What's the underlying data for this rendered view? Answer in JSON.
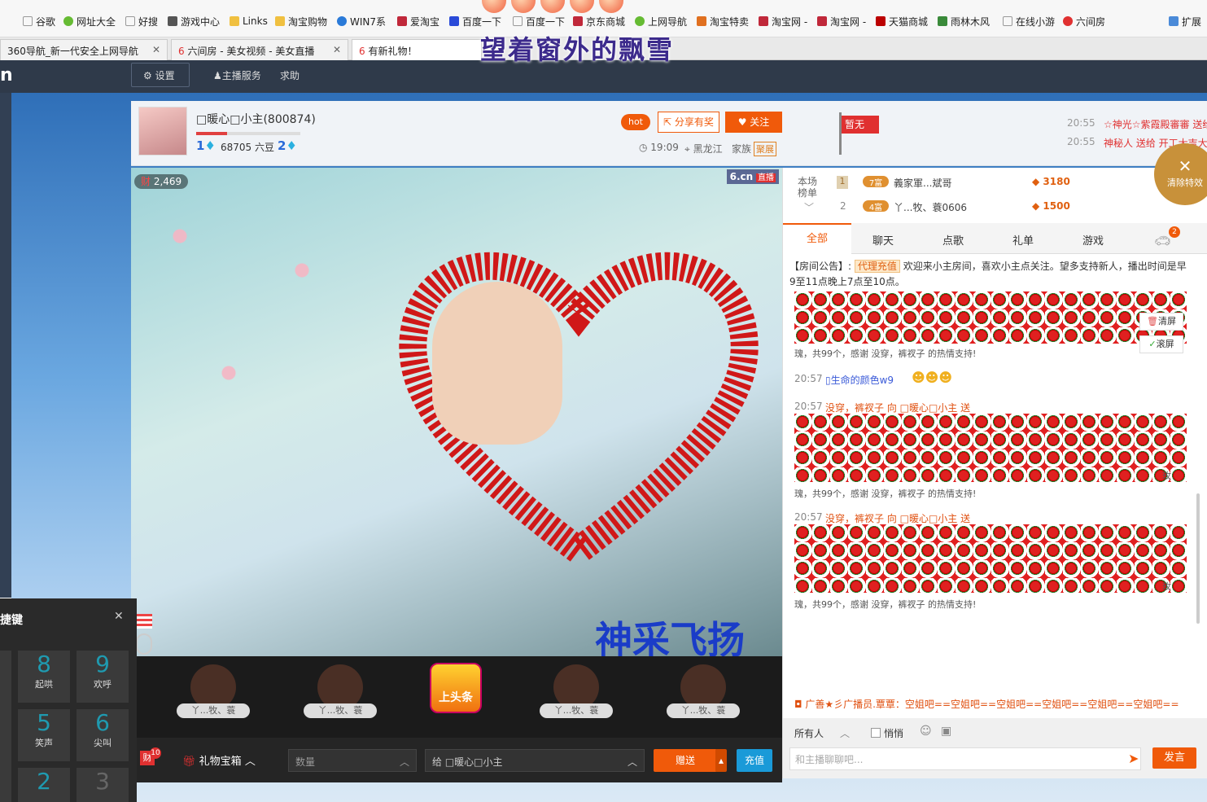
{
  "bookmarks": [
    {
      "label": "谷歌",
      "icon": "page-icon"
    },
    {
      "label": "网址大全",
      "icon": "360-icon"
    },
    {
      "label": "好搜",
      "icon": "page-icon"
    },
    {
      "label": "游戏中心",
      "icon": "gamepad-icon"
    },
    {
      "label": "Links",
      "icon": "folder-icon"
    },
    {
      "label": "淘宝购物",
      "icon": "folder-icon"
    },
    {
      "label": "WIN7系",
      "icon": "ie-icon"
    },
    {
      "label": "爱淘宝",
      "icon": "taobao-icon"
    },
    {
      "label": "百度一下",
      "icon": "baidu-icon"
    },
    {
      "label": "百度一下",
      "icon": "page-icon"
    },
    {
      "label": "京东商城",
      "icon": "jd-icon"
    },
    {
      "label": "上网导航",
      "icon": "360-icon"
    },
    {
      "label": "淘宝特卖",
      "icon": "taobao-icon"
    },
    {
      "label": "淘宝网 -",
      "icon": "jd-icon"
    },
    {
      "label": "淘宝网 -",
      "icon": "jd-icon"
    },
    {
      "label": "天猫商城",
      "icon": "tmall-icon"
    },
    {
      "label": "雨林木风",
      "icon": "tree-icon"
    },
    {
      "label": "在线小游",
      "icon": "page-icon"
    },
    {
      "label": "六间房",
      "icon": "6cn-icon"
    },
    {
      "label": "扩展",
      "icon": "extension-icon"
    }
  ],
  "tabs": [
    {
      "label": "360导航_新一代安全上网导航"
    },
    {
      "label": "六间房 - 美女视频 - 美女直播"
    },
    {
      "label": "有新礼物！"
    }
  ],
  "overlay_title": "望着窗外的飘雪",
  "topnav": {
    "settings": "设置",
    "anchor_service": "主播服务",
    "help": "求助"
  },
  "header": {
    "anchor_name": "□暖心□小主(800874)",
    "level_left": "1",
    "beans": "68705 六豆",
    "level_right": "2",
    "hot_label": "hot",
    "share_label": "分享有奖",
    "follow_label": "关注",
    "time": "19:09",
    "location": "黑龙江",
    "family_label": "家族",
    "family_badge": "聚展",
    "flag_label": "暂无",
    "notices": [
      {
        "time": "20:55",
        "text": "☆神光☆紫霞殿審審 送给"
      },
      {
        "time": "20:55",
        "text": "神秘人 送给 开工大吉大"
      }
    ]
  },
  "video": {
    "wealth_count": "2,469",
    "brand": "6.cn",
    "live": "直播",
    "banner": "神采飞扬"
  },
  "gifts": [
    {
      "name": "丫...牧、蓑"
    },
    {
      "name": "丫...牧、蓑"
    },
    {
      "name": "上头条"
    },
    {
      "name": "丫...牧、蓑"
    },
    {
      "name": "丫...牧、蓑"
    }
  ],
  "bottombar": {
    "wealth_badge": "10",
    "gift_box": "礼物宝箱",
    "quantity_placeholder": "数量",
    "give_to": "给 □暖心□小主",
    "send": "赠送",
    "recharge": "充值"
  },
  "ranking": {
    "label": "本场榜单",
    "rows": [
      {
        "rank": "1",
        "badge": "7富",
        "name": "義家軍...斌哥",
        "score": "3180"
      },
      {
        "rank": "2",
        "badge": "4富",
        "name": "丫...牧、蓑0606",
        "score": "1500"
      }
    ],
    "clear_effects": "清除特效"
  },
  "chat_tabs": [
    "全部",
    "聊天",
    "点歌",
    "礼单",
    "游戏"
  ],
  "car_badge": "2",
  "announcement": {
    "prefix": "【房间公告】:",
    "agent": "代理充值",
    "text": "欢迎来小主房间，喜欢小主点关注。望多支持新人，播出时间是早9至11点晚上7点至10点。"
  },
  "side_actions": {
    "clear": "清屏",
    "scroll": "滚屏"
  },
  "messages": [
    {
      "time": "",
      "text": "瑰，共99个，感谢 没穿，裤衩子 的热情支持!",
      "tail": ""
    },
    {
      "time": "20:57",
      "user": "生命的颜色w9",
      "text": ""
    },
    {
      "time": "20:57",
      "text": "没穿，裤衩子 向 □暖心□小主 送",
      "footer": "瑰，共99个，感谢 没穿，裤衩子 的热情支持!",
      "tail": "玫"
    },
    {
      "time": "20:57",
      "text": "没穿，裤衩子 向 □暖心□小主 送",
      "footer": "瑰，共99个，感谢 没穿，裤衩子 的热情支持!",
      "tail": "玫"
    }
  ],
  "broadcast": "广善★彡广播员.覃覃：空姐吧==空姐吧==空姐吧==空姐吧==空姐吧==空姐吧==",
  "chat_input": {
    "target": "所有人",
    "whisper": "悄悄",
    "placeholder": "和主播聊聊吧...",
    "send": "发言"
  },
  "keypad": {
    "title": "捷键",
    "keys": [
      {
        "num": "8",
        "label": "起哄"
      },
      {
        "num": "9",
        "label": "欢呼"
      },
      {
        "num": "5",
        "label": "笑声"
      },
      {
        "num": "6",
        "label": "尖叫"
      },
      {
        "num": "2",
        "label": ""
      },
      {
        "num": "3",
        "label": ""
      }
    ]
  }
}
